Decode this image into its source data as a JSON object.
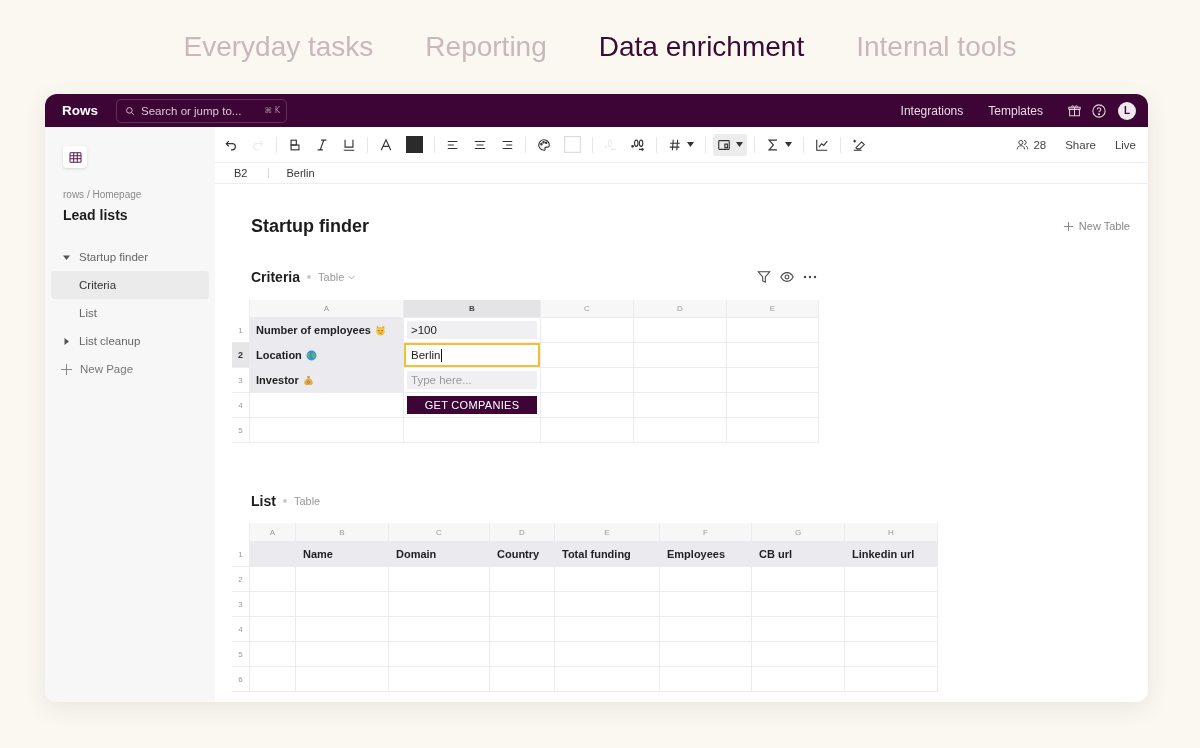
{
  "nav_tabs": [
    {
      "label": "Everyday tasks",
      "selected": false
    },
    {
      "label": "Reporting",
      "selected": false
    },
    {
      "label": "Data enrichment",
      "selected": true
    },
    {
      "label": "Internal tools",
      "selected": false
    }
  ],
  "header": {
    "logo": "Rows",
    "search": {
      "placeholder": "Search or jump to...",
      "shortcut": "⌘ K"
    },
    "links": [
      "Integrations",
      "Templates"
    ],
    "avatar": "L"
  },
  "toolbar": {
    "tools": [
      {
        "disabled": false,
        "pressed": false
      },
      {
        "disabled": true,
        "pressed": false
      },
      {
        "disabled": false,
        "pressed": false
      },
      {
        "disabled": false,
        "pressed": false
      },
      {
        "disabled": false,
        "pressed": false
      },
      {
        "disabled": false,
        "pressed": false
      },
      {
        "disabled": false,
        "pressed": false
      },
      {
        "disabled": false,
        "pressed": false
      },
      {
        "disabled": false,
        "pressed": false
      },
      {
        "disabled": false,
        "pressed": false
      },
      {
        "disabled": false,
        "pressed": false
      },
      {
        "disabled": false,
        "pressed": false
      },
      {
        "disabled": true,
        "pressed": false
      },
      {
        "disabled": false,
        "pressed": false
      },
      {
        "disabled": false,
        "pressed": false
      },
      {
        "disabled": false,
        "pressed": true
      },
      {
        "disabled": false,
        "pressed": false
      },
      {
        "disabled": false,
        "pressed": false
      },
      {
        "disabled": false,
        "pressed": false
      }
    ],
    "collaborators": "28",
    "actions": [
      "Share",
      "Live"
    ]
  },
  "formula_bar": {
    "cell": "B2",
    "value": "Berlin"
  },
  "sidebar": {
    "breadcrumb": "rows / Homepage",
    "title": "Lead lists",
    "pages": [
      {
        "label": "Startup finder",
        "selected": false,
        "expanded": true,
        "children": [
          {
            "label": "Criteria",
            "selected": true
          },
          {
            "label": "List",
            "selected": false
          }
        ]
      },
      {
        "label": "List cleanup",
        "selected": false,
        "expanded": false
      }
    ],
    "new_page": "New Page"
  },
  "page": {
    "title": "Startup finder",
    "new_table": "New Table"
  },
  "criteria_table": {
    "name": "Criteria",
    "type": "Table",
    "type_menu": true,
    "actions_shown": true,
    "columns": [
      {
        "label": "A",
        "selected": false
      },
      {
        "label": "B",
        "selected": true
      },
      {
        "label": "C",
        "selected": false
      },
      {
        "label": "D",
        "selected": false
      },
      {
        "label": "E",
        "selected": false
      }
    ],
    "rows": [
      {
        "number": "1",
        "selected": false,
        "kind": "input",
        "label": "Number of employees",
        "value": ">100",
        "active": false
      },
      {
        "number": "2",
        "selected": true,
        "kind": "input",
        "label": "Location",
        "value": "Berlin",
        "active": true
      },
      {
        "number": "3",
        "selected": false,
        "kind": "input",
        "label": "Investor",
        "placeholder": "Type here...",
        "active": false
      },
      {
        "number": "4",
        "selected": false,
        "kind": "button",
        "button": "GET COMPANIES"
      },
      {
        "number": "5",
        "selected": false,
        "kind": "empty"
      }
    ]
  },
  "list_table": {
    "name": "List",
    "type": "Table",
    "type_menu": false,
    "actions_shown": false,
    "columns": [
      {
        "label": "A",
        "selected": false
      },
      {
        "label": "B",
        "selected": false
      },
      {
        "label": "C",
        "selected": false
      },
      {
        "label": "D",
        "selected": false
      },
      {
        "label": "E",
        "selected": false
      },
      {
        "label": "F",
        "selected": false
      },
      {
        "label": "G",
        "selected": false
      },
      {
        "label": "H",
        "selected": false
      }
    ],
    "header_row": {
      "number": "1",
      "selected": false,
      "labels": [
        "Name",
        "Domain",
        "Country",
        "Total funding",
        "Employees",
        "CB url",
        "Linkedin url"
      ]
    },
    "rows": [
      {
        "number": "2",
        "selected": false
      },
      {
        "number": "3",
        "selected": false
      },
      {
        "number": "4",
        "selected": false
      },
      {
        "number": "5",
        "selected": false
      },
      {
        "number": "6",
        "selected": false
      }
    ]
  }
}
